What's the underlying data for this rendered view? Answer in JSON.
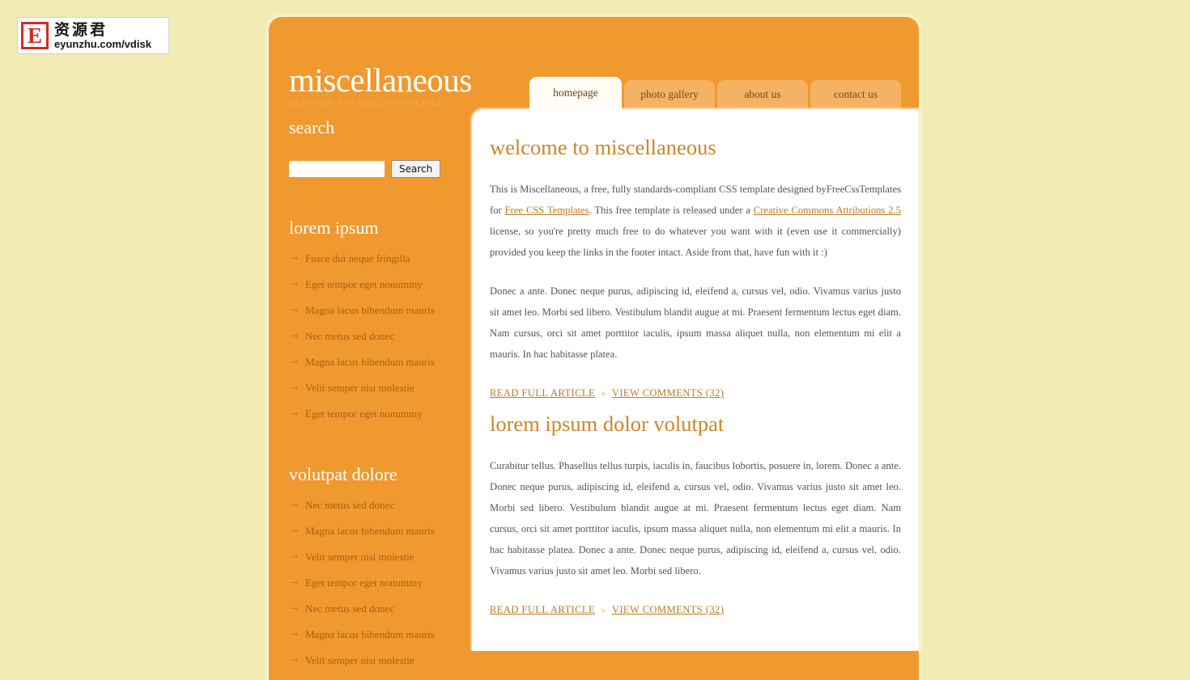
{
  "watermark": {
    "badge_letter": "E",
    "cn_text": "资源君",
    "url_text": "eyunzhu.com/vdisk"
  },
  "header": {
    "site_title": "miscellaneous",
    "tagline": "DESIGNED BY FREECSSTEMPLATES"
  },
  "nav": {
    "items": [
      {
        "label": "homepage",
        "active": true
      },
      {
        "label": "photo gallery",
        "active": false
      },
      {
        "label": "about us",
        "active": false
      },
      {
        "label": "contact us",
        "active": false
      }
    ]
  },
  "sidebar": {
    "search": {
      "heading": "search",
      "input_value": "",
      "input_placeholder": "",
      "button_label": "Search"
    },
    "blocks": [
      {
        "heading": "lorem ipsum",
        "arrow": "→",
        "items": [
          "Fusce dui neque fringilla",
          "Eget tempor eget nonummy",
          "Magna lacus bibendum mauris",
          "Nec metus sed donec",
          "Magna lacus bibendum mauris",
          "Velit semper nisi molestie",
          "Eget tempor eget nonummy"
        ]
      },
      {
        "heading": "volutpat dolore",
        "arrow": "→",
        "items": [
          "Nec metus sed donec",
          "Magna lacus bibendum mauris",
          "Velit semper nisi molestie",
          "Eget tempor eget nonummy",
          "Nec metus sed donec",
          "Magna lacus bibendum mauris",
          "Velit semper nisi molestie"
        ]
      }
    ]
  },
  "main": {
    "posts": [
      {
        "title": "welcome to miscellaneous",
        "para1_a": "This is Miscellaneous, a free, fully standards-compliant CSS template designed byFreeCssTemplates for ",
        "para1_link1": "Free CSS Templates",
        "para1_b": ". This free template is released under a ",
        "para1_link2": "Creative Commons Attributions 2.5",
        "para1_c": " license, so you're pretty much free to do whatever you want with it (even use it commercially) provided you keep the links in the footer intact. Aside from that, have fun with it :)",
        "para2": "Donec a ante. Donec neque purus, adipiscing id, eleifend a, cursus vel, odio. Vivamus varius justo sit amet leo. Morbi sed libero. Vestibulum blandit augue at mi. Praesent fermentum lectus eget diam. Nam cursus, orci sit amet porttitor iaculis, ipsum massa aliquet nulla, non elementum mi elit a mauris. In hac habitasse platea.",
        "read_more": "READ FULL ARTICLE",
        "separator": "»",
        "comments": "VIEW COMMENTS (32)"
      },
      {
        "title": "lorem ipsum dolor volutpat",
        "para1": "Curabitur tellus. Phasellus tellus turpis, iaculis in, faucibus lobortis, posuere in, lorem. Donec a ante. Donec neque purus, adipiscing id, eleifend a, cursus vel, odio. Vivamus varius justo sit amet leo. Morbi sed libero. Vestibulum blandit augue at mi. Praesent fermentum lectus eget diam. Nam cursus, orci sit amet porttitor iaculis, ipsum massa aliquet nulla, non elementum mi elit a mauris. In hac habitasse platea. Donec a ante. Donec neque purus, adipiscing id, eleifend a, cursus vel, odio. Vivamus varius justo sit amet leo. Morbi sed libero.",
        "read_more": "READ FULL ARTICLE",
        "separator": "»",
        "comments": "VIEW COMMENTS (32)"
      }
    ]
  },
  "colors": {
    "page_bg": "#f2ecb4",
    "orange": "#f0992e",
    "tab_inactive": "#f5b264",
    "tab_active": "#fffdf6",
    "heading": "#cd8626",
    "link": "#bb7a22",
    "sidebar_link": "#a56210"
  }
}
